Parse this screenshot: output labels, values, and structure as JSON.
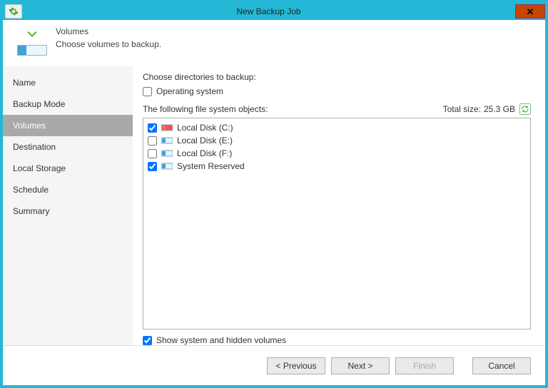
{
  "window": {
    "title": "New Backup Job"
  },
  "header": {
    "title": "Volumes",
    "subtitle": "Choose volumes to backup."
  },
  "steps": [
    {
      "label": "Name",
      "active": false
    },
    {
      "label": "Backup Mode",
      "active": false
    },
    {
      "label": "Volumes",
      "active": true
    },
    {
      "label": "Destination",
      "active": false
    },
    {
      "label": "Local Storage",
      "active": false
    },
    {
      "label": "Schedule",
      "active": false
    },
    {
      "label": "Summary",
      "active": false
    }
  ],
  "main": {
    "choose_label": "Choose directories to backup:",
    "os_checkbox": {
      "label": "Operating system",
      "checked": false
    },
    "list_label": "The following file system objects:",
    "total": {
      "label": "Total size:",
      "value": "25.3 GB"
    },
    "volumes": [
      {
        "label": "Local Disk (C:)",
        "checked": true,
        "primary": true
      },
      {
        "label": "Local Disk (E:)",
        "checked": false,
        "primary": false
      },
      {
        "label": "Local Disk (F:)",
        "checked": false,
        "primary": false
      },
      {
        "label": "System Reserved",
        "checked": true,
        "primary": false
      }
    ],
    "show_hidden": {
      "label": "Show system and hidden volumes",
      "checked": true
    }
  },
  "footer": {
    "previous": "< Previous",
    "next": "Next >",
    "finish": "Finish",
    "cancel": "Cancel",
    "finish_enabled": false
  },
  "icons": {
    "gear": "gear-icon",
    "close": "close-icon",
    "arrow": "download-arrow-icon",
    "disk": "disk-icon",
    "refresh": "refresh-icon"
  }
}
